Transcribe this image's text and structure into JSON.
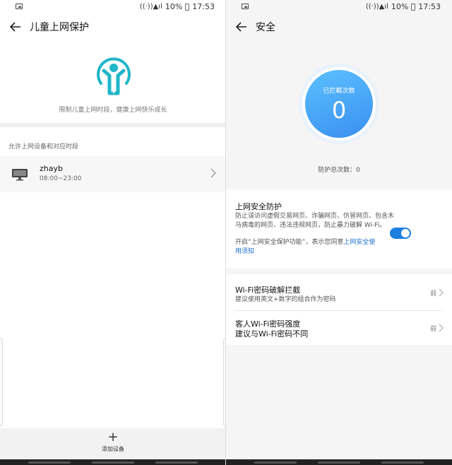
{
  "status_bar": {
    "battery": "10%",
    "time": "17:53"
  },
  "left": {
    "title": "儿童上网保护",
    "caption": "限制儿童上网时段，健康上网快乐成长",
    "section_label": "允许上网设备和对应时段",
    "device": {
      "name": "zhayb",
      "time": "08:00~23:00"
    },
    "add_label": "添加设备",
    "add_symbol": "+",
    "accent_color": "#1fb6c8"
  },
  "right": {
    "title": "安全",
    "blocked_caption": "已拦截次数",
    "blocked_count": "0",
    "total_line": "防护总次数：0",
    "protect": {
      "title": "上网安全防护",
      "desc": "防止误访问虚假交易网页、诈骗网页、仿冒网页、包含木马病毒的网页、违法违规网页，防止暴力破解 Wi-Fi。",
      "notice_prefix": "开启“上网安全保护功能”，表示您同意",
      "notice_link": "上网安全使用须知",
      "enabled": true
    },
    "wifi_crack": {
      "title": "Wi-Fi密码破解拦截",
      "desc": "建议使用英文+数字的组合作为密码",
      "level": "弱"
    },
    "guest_wifi": {
      "title": "客人Wi-Fi密码强度",
      "desc": "建议与Wi-Fi密码不同",
      "level": "弱"
    },
    "accent_color": "#1e7fe0"
  }
}
